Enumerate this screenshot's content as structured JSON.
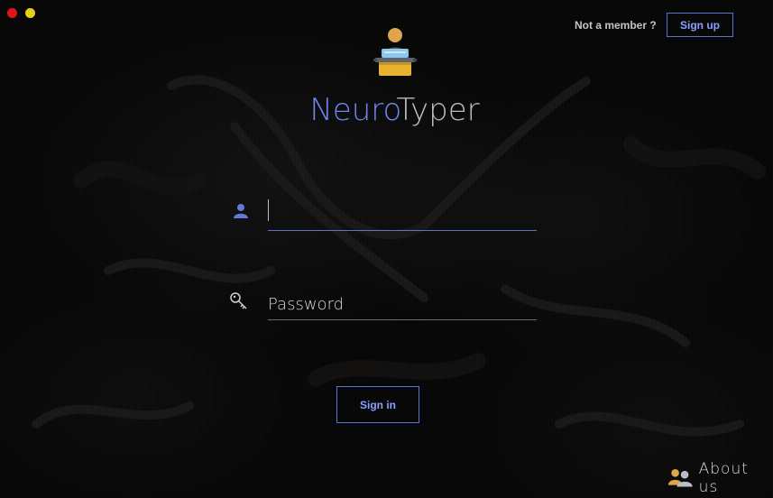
{
  "window": {
    "controls": [
      "close",
      "minimize"
    ]
  },
  "header": {
    "not_member_text": "Not a member ?",
    "signup_label": "Sign up"
  },
  "brand": {
    "logo_icon": "typist-icon",
    "title_part1": "Neuro",
    "title_part2": "Typer",
    "title_colors": {
      "part1": "#6f86ea",
      "part2": "#bcbcbc"
    }
  },
  "login_form": {
    "username": {
      "icon": "user-icon",
      "value": "",
      "placeholder": ""
    },
    "password": {
      "icon": "key-icon",
      "value": "",
      "placeholder": "Password"
    },
    "signin_label": "Sign in"
  },
  "footer": {
    "about_icon": "users-icon",
    "about_label": "About us"
  },
  "colors": {
    "accent": "#5a72d6",
    "background": "#070708",
    "close_dot": "#e0141b",
    "minimize_dot": "#e5d311"
  }
}
